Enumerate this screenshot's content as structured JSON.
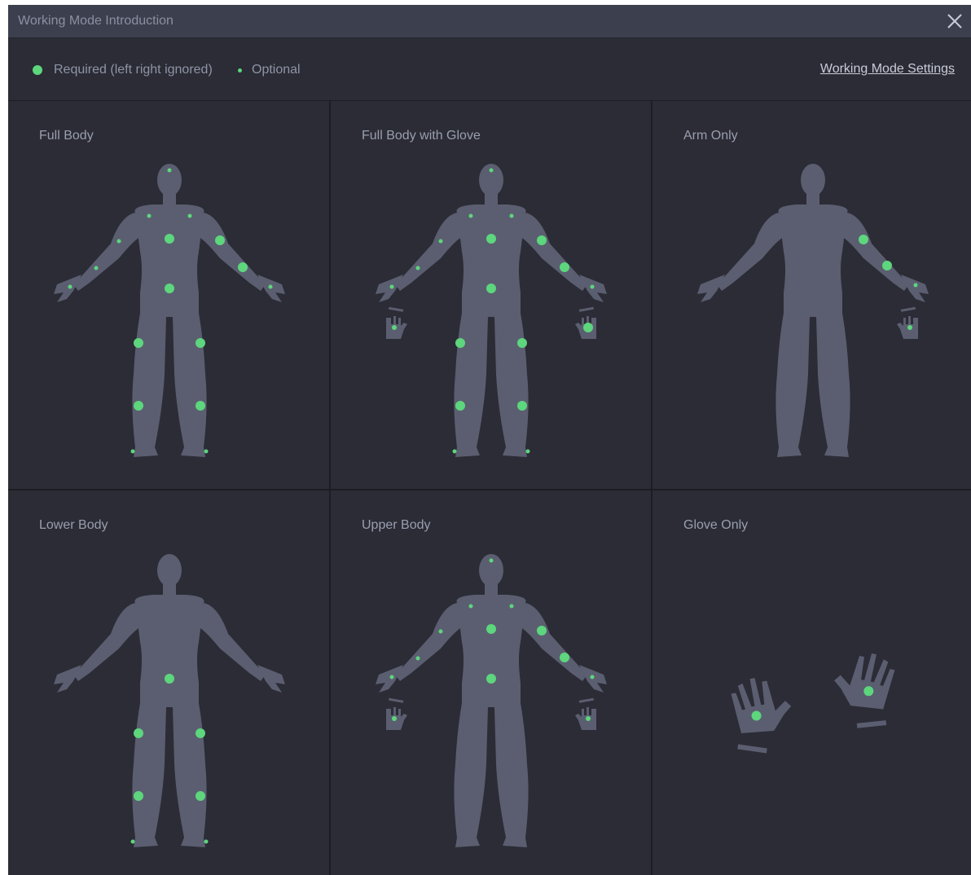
{
  "window": {
    "title": "Working Mode Introduction"
  },
  "legend": {
    "required": "Required (left right ignored)",
    "optional": "Optional"
  },
  "settings_link": "Working Mode Settings",
  "colors": {
    "background": "#2b2c35",
    "titlebar": "#3c3f4e",
    "body_silhouette": "#5b5e70",
    "sensor": "#5dd67d"
  },
  "modes": [
    {
      "label": "Full Body"
    },
    {
      "label": "Full Body with Glove"
    },
    {
      "label": "Arm Only"
    },
    {
      "label": "Lower Body"
    },
    {
      "label": "Upper Body"
    },
    {
      "label": "Glove Only"
    }
  ],
  "icons": {
    "close": "close-icon"
  }
}
